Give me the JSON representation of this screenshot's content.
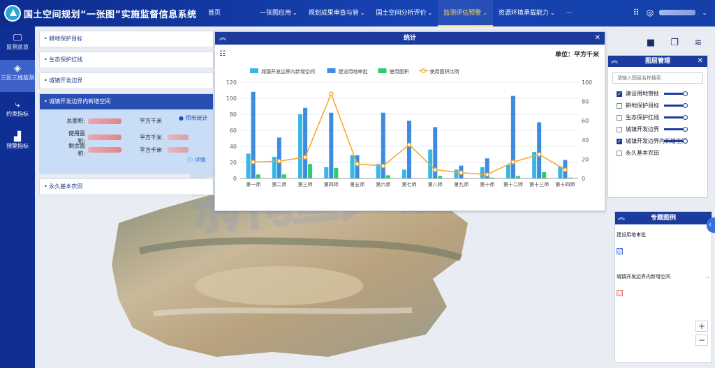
{
  "header": {
    "title": "国土空间规划“一张图”实施监督信息系统",
    "nav": [
      {
        "label": "首页",
        "caret": false,
        "active": false
      },
      {
        "label": "一张图应用",
        "caret": true,
        "active": false
      },
      {
        "label": "规划成果审查与管",
        "caret": true,
        "active": false
      },
      {
        "label": "国土空间分析评价",
        "caret": true,
        "active": false
      },
      {
        "label": "监测评估预警",
        "caret": true,
        "active": true
      },
      {
        "label": "资源环境承载能力",
        "caret": true,
        "active": false
      },
      {
        "label": "···",
        "caret": false,
        "active": false
      }
    ]
  },
  "rail": [
    {
      "label": "监测总览",
      "icon": "monitor-icon"
    },
    {
      "label": "三区三线监测",
      "icon": "layers-icon"
    },
    {
      "label": "约束指标",
      "icon": "flow-icon"
    },
    {
      "label": "预警指标",
      "icon": "bar-chart-icon"
    }
  ],
  "accordion": {
    "items": [
      "耕地保护目标",
      "生态保护红线",
      "城镇开发边界",
      "城镇开发边界内新增空间",
      "永久基本农田"
    ],
    "city_stat": "师市统计",
    "detail_link": "详情",
    "rows": [
      {
        "label": "总面积:",
        "unit": "平方千米"
      },
      {
        "label": "使用面积:",
        "unit": "平方千米"
      },
      {
        "label": "剩余面积:",
        "unit": "平方千米"
      }
    ]
  },
  "stats": {
    "title": "统计",
    "unit": "单位：平方千米"
  },
  "chart_data": {
    "type": "bar",
    "categories": [
      "第一师",
      "第二师",
      "第三师",
      "第四师",
      "第五师",
      "第六师",
      "第七师",
      "第八师",
      "第九师",
      "第十师",
      "第十二师",
      "第十三师",
      "第十四师"
    ],
    "series": [
      {
        "name": "城镇开发边界内新增空间",
        "type": "bar",
        "axis": "left",
        "color": "#35b7e8",
        "values": [
          31,
          27,
          80,
          14,
          29,
          18,
          11,
          36,
          11,
          14,
          17,
          33,
          15
        ]
      },
      {
        "name": "建设用地审批",
        "type": "bar",
        "axis": "left",
        "color": "#3d8ce0",
        "values": [
          108,
          51,
          88,
          82,
          29,
          82,
          72,
          64,
          16,
          25,
          103,
          70,
          23
        ]
      },
      {
        "name": "使用面积",
        "type": "bar",
        "axis": "left",
        "color": "#2ecc71",
        "values": [
          5,
          5,
          18,
          13,
          0,
          4,
          0,
          3,
          0,
          1,
          3,
          8,
          1
        ]
      },
      {
        "name": "使用面积比例",
        "type": "line",
        "axis": "right",
        "color": "#f5a623",
        "values": [
          17,
          18,
          22,
          88,
          15,
          13,
          35,
          9,
          6,
          4,
          17,
          25,
          9
        ]
      }
    ],
    "ylim_left": [
      0,
      120
    ],
    "ylim_right": [
      0,
      100
    ],
    "yticks_left": [
      0,
      20,
      40,
      60,
      80,
      100,
      120
    ],
    "yticks_right": [
      0,
      20,
      40,
      60,
      80,
      100
    ],
    "grid": true,
    "legend": "top"
  },
  "layers": {
    "title": "图层管理",
    "search_placeholder": "请输入图层名称搜索",
    "items": [
      {
        "label": "建设用地审批",
        "checked": true
      },
      {
        "label": "耕地保护目标",
        "checked": false
      },
      {
        "label": "生态保护红线",
        "checked": false
      },
      {
        "label": "城镇开发边界",
        "checked": false
      },
      {
        "label": "城镇开发边界内新增空间",
        "checked": true
      },
      {
        "label": "永久基本农田",
        "checked": false
      }
    ]
  },
  "legend": {
    "title": "专题图例",
    "items": [
      {
        "label": "建设用地审批",
        "swatch": "blue-hatch"
      },
      {
        "label": "城镇开发边界内新增空间",
        "swatch": "red-hatch"
      }
    ]
  },
  "watermark": "新疆兵团"
}
